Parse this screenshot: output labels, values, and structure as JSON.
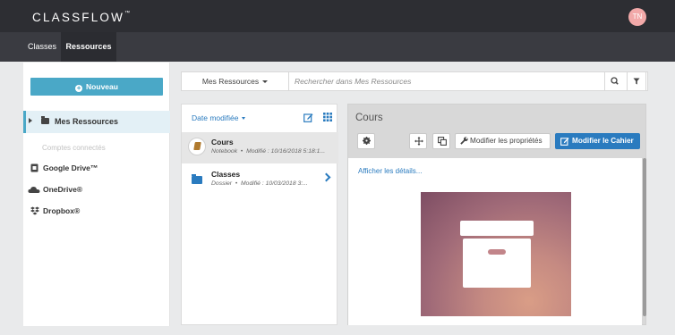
{
  "app": {
    "logo": "CLASSFLOW",
    "logo_tm": "™",
    "avatar_initials": "TN",
    "brand_color": "#2d2e33",
    "accent": "#4aa8c7",
    "link_color": "#2a7bbf"
  },
  "nav": {
    "tabs": [
      {
        "label": "Classes"
      },
      {
        "label": "Ressources",
        "active": true
      }
    ]
  },
  "sidebar": {
    "new_button": "Nouveau",
    "active_item": "Mes Ressources",
    "connected_label": "Comptes connectés",
    "accounts": [
      {
        "label": "Google Drive™",
        "icon": "google-drive-icon"
      },
      {
        "label": "OneDrive®",
        "icon": "onedrive-cloud-icon"
      },
      {
        "label": "Dropbox®",
        "icon": "dropbox-icon"
      }
    ]
  },
  "search": {
    "scope": "Mes Ressources",
    "placeholder": "Rechercher dans Mes Ressources"
  },
  "list": {
    "sort_label": "Date modifiée",
    "items": [
      {
        "name": "Cours",
        "type": "Notebook",
        "separator": "•",
        "modified": "Modifié : 10/16/2018 5:18:1...",
        "icon": "notebook-icon"
      },
      {
        "name": "Classes",
        "type": "Dossier",
        "separator": "•",
        "modified": "Modifié : 10/03/2018 3:...",
        "icon": "folder-icon"
      }
    ]
  },
  "detail": {
    "title": "Cours",
    "edit_props": "Modifier les propriétés",
    "edit_notebook": "Modifier le Cahier",
    "details_link": "Afficher les détails..."
  }
}
